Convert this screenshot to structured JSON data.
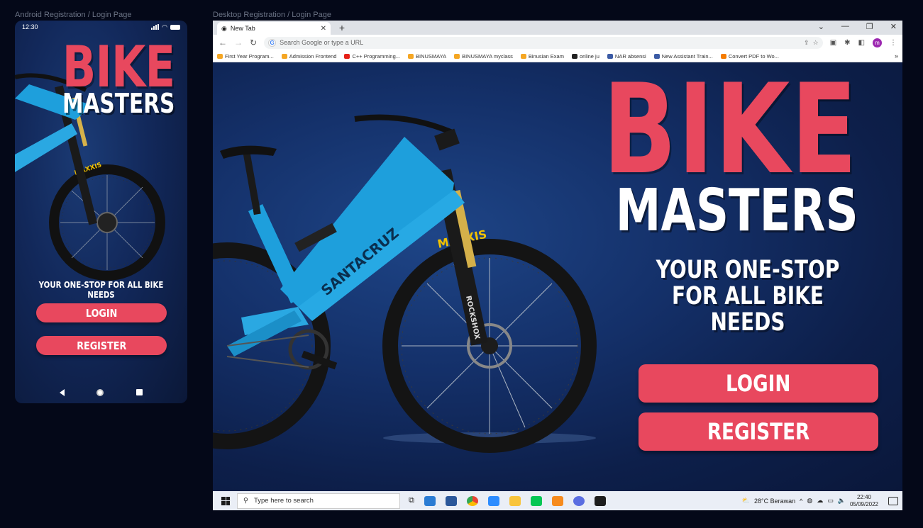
{
  "labels": {
    "android": "Android Registration / Login Page",
    "desktop": "Desktop Registration / Login Page"
  },
  "brand": {
    "line1": "BIKE",
    "line2": "MASTERS",
    "tagline": "YOUR ONE-STOP FOR ALL BIKE NEEDS",
    "tagline_line1": "YOUR ONE-STOP",
    "tagline_line2": "FOR ALL BIKE NEEDS",
    "login": "LOGIN",
    "register": "REGISTER",
    "accent_color": "#e8485e"
  },
  "bike_marks": {
    "tire": "MAXXIS",
    "frame": "SANTACRUZ",
    "fork": "ROCKSHOX"
  },
  "phone": {
    "time": "12:30"
  },
  "browser": {
    "tab_title": "New Tab",
    "omnibox_placeholder": "Search Google or type a URL",
    "profile_initial": "m",
    "bookmarks": [
      {
        "label": "First Year Program...",
        "color": "#f5a623"
      },
      {
        "label": "Admission Frontend",
        "color": "#f5a623"
      },
      {
        "label": "C++ Programming...",
        "color": "#e62117"
      },
      {
        "label": "BINUSMAYA",
        "color": "#f5a623"
      },
      {
        "label": "BINUSMAYA myclass",
        "color": "#f5a623"
      },
      {
        "label": "Binusian Exam",
        "color": "#f5a623"
      },
      {
        "label": "online ju",
        "color": "#222222"
      },
      {
        "label": "NAR absensi",
        "color": "#3b5ba5"
      },
      {
        "label": "New Assistant Train...",
        "color": "#3b5ba5"
      },
      {
        "label": "Convert PDF to Wo...",
        "color": "#f57c00"
      }
    ],
    "more": "»"
  },
  "taskbar": {
    "search_placeholder": "Type here to search",
    "weather": "28°C  Berawan",
    "time": "22:40",
    "date": "05/09/2022"
  }
}
